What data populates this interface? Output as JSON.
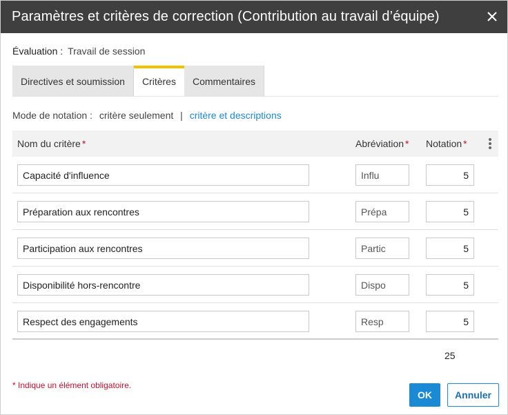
{
  "dialog": {
    "title": "Paramètres et critères de correction (Contribution au travail d’équipe)",
    "close_icon": "close-icon"
  },
  "evaluation": {
    "label": "Évaluation :",
    "value": "Travail de session"
  },
  "tabs": [
    {
      "label": "Directives et soumission",
      "active": false
    },
    {
      "label": "Critères",
      "active": true
    },
    {
      "label": "Commentaires",
      "active": false
    }
  ],
  "mode": {
    "label": "Mode de notation :",
    "option_plain": "critère seulement",
    "separator": "|",
    "option_link": "critère et descriptions"
  },
  "table": {
    "col_name": "Nom du critère",
    "col_abbr": "Abréviation",
    "col_note": "Notation",
    "required_mark": "*",
    "menu_icon": "kebab-menu-icon",
    "rows": [
      {
        "name": "Capacité d'influence",
        "abbr": "Influ",
        "note": "5"
      },
      {
        "name": "Préparation aux rencontres",
        "abbr": "Prépa",
        "note": "5"
      },
      {
        "name": "Participation aux rencontres",
        "abbr": "Partic",
        "note": "5"
      },
      {
        "name": "Disponibilité hors-rencontre",
        "abbr": "Dispo",
        "note": "5"
      },
      {
        "name": "Respect des engagements",
        "abbr": "Resp",
        "note": "5"
      }
    ],
    "total": "25"
  },
  "footnote": "* Indique un élément obligatoire.",
  "buttons": {
    "ok": "OK",
    "cancel": "Annuler"
  },
  "colors": {
    "header_bg": "#3f3f3f",
    "accent_blue": "#1a8ad4",
    "active_tab": "#f2c200",
    "required_red": "#c8102e"
  }
}
